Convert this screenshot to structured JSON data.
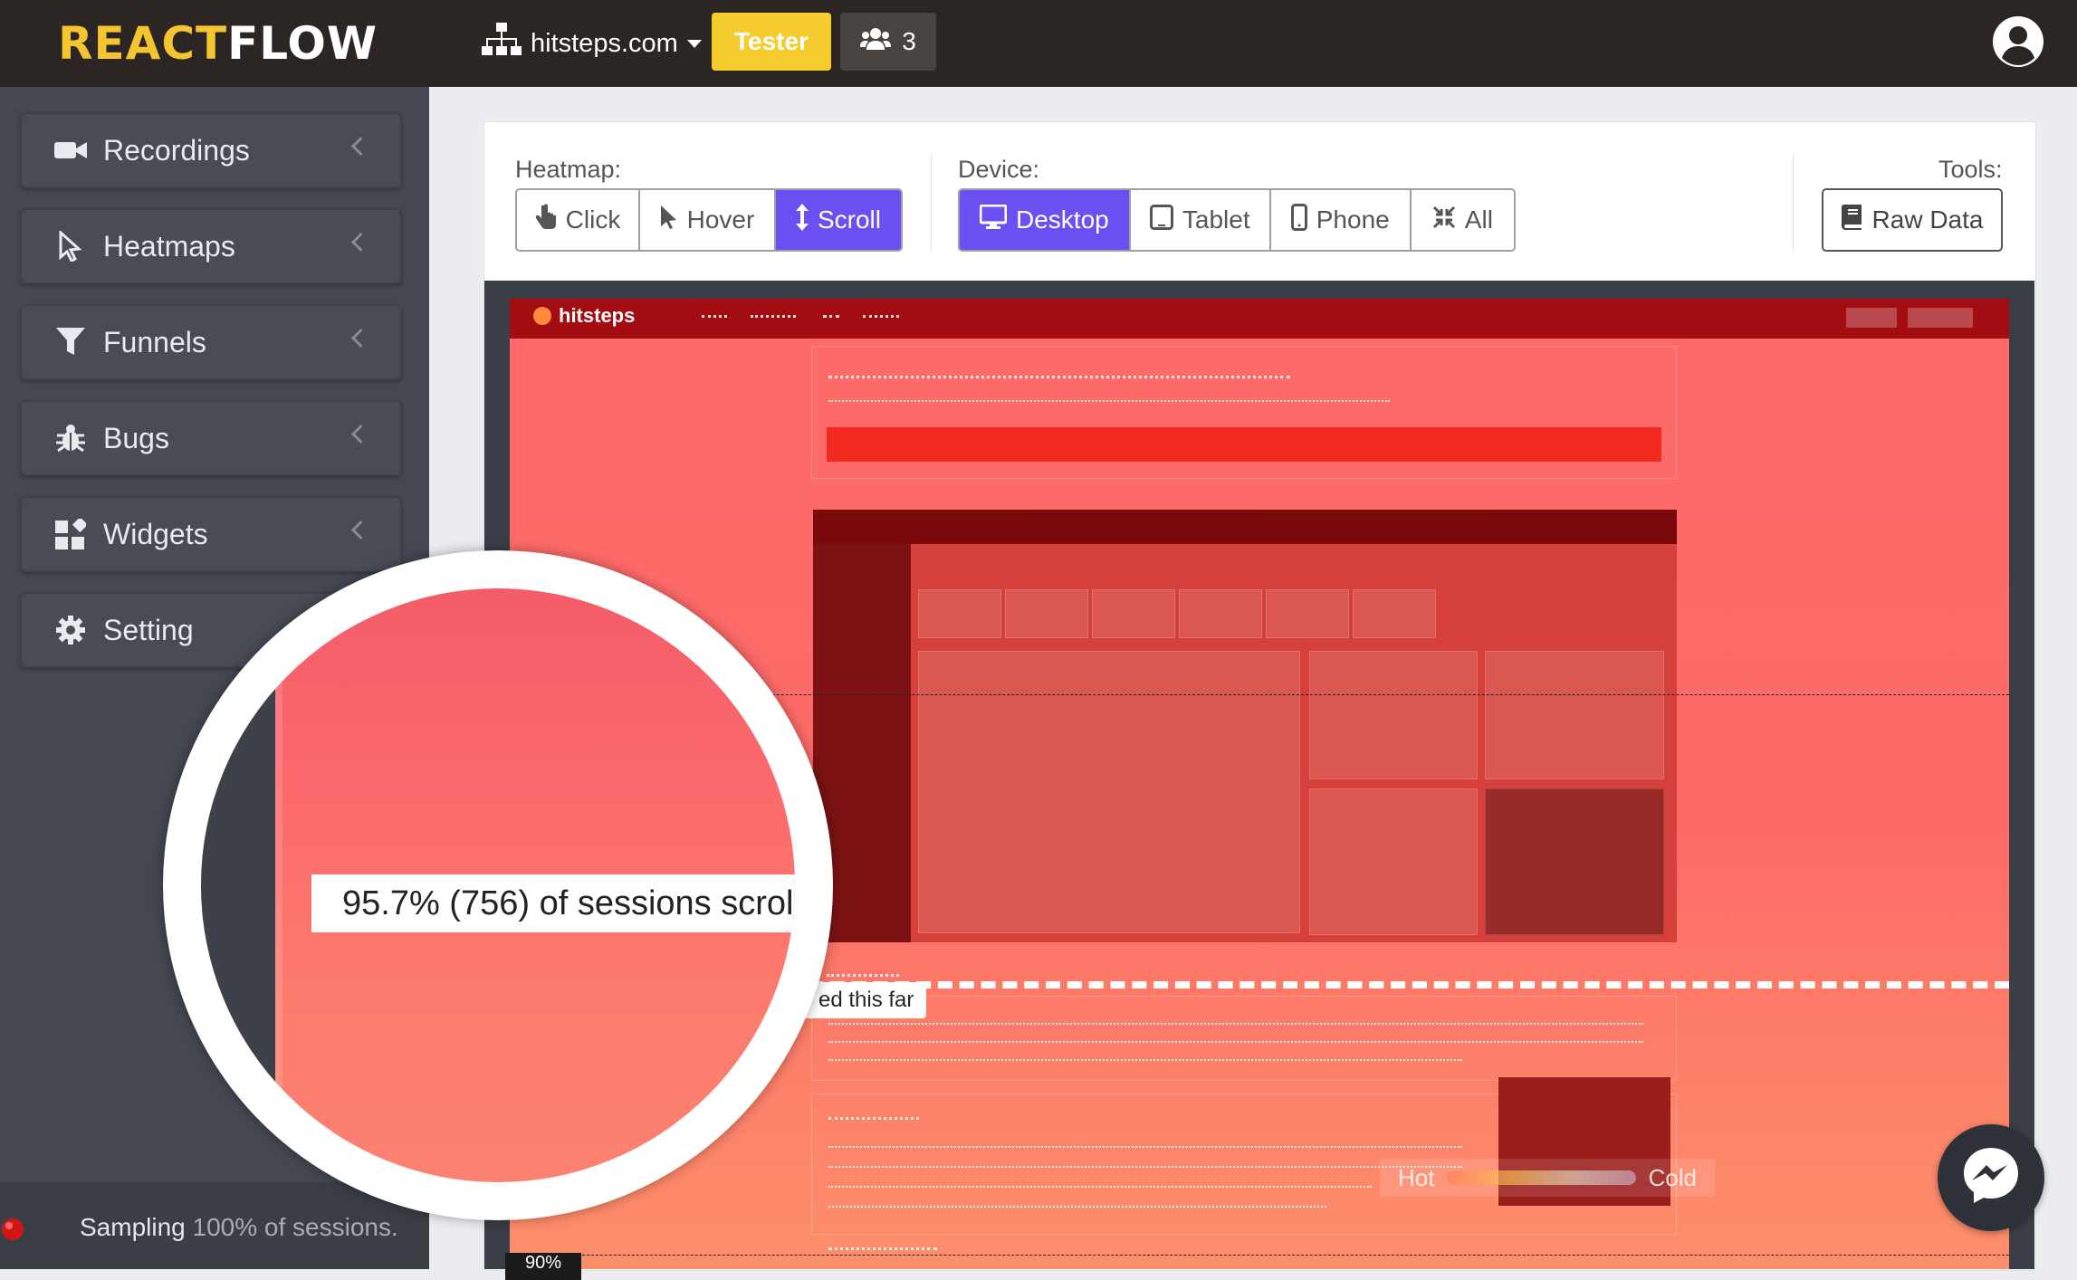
{
  "app": {
    "logo_part1": "REACT",
    "logo_part2": "FLOW"
  },
  "topbar": {
    "site": "hitsteps.com",
    "tester_label": "Tester",
    "users_count": "3"
  },
  "sidebar": {
    "items": [
      {
        "label": "Recordings",
        "icon": "video-camera-icon"
      },
      {
        "label": "Heatmaps",
        "icon": "cursor-icon"
      },
      {
        "label": "Funnels",
        "icon": "filter-icon"
      },
      {
        "label": "Bugs",
        "icon": "bug-icon"
      },
      {
        "label": "Widgets",
        "icon": "widgets-icon"
      },
      {
        "label": "Setting",
        "icon": "gear-icon"
      }
    ],
    "sampling_label": "Sampling",
    "sampling_value": "100% of sessions."
  },
  "toolbar": {
    "heatmap_label": "Heatmap:",
    "heatmap_types": [
      {
        "label": "Click",
        "active": false
      },
      {
        "label": "Hover",
        "active": false
      },
      {
        "label": "Scroll",
        "active": true
      }
    ],
    "device_label": "Device:",
    "devices": [
      {
        "label": "Desktop",
        "active": true
      },
      {
        "label": "Tablet",
        "active": false
      },
      {
        "label": "Phone",
        "active": false
      },
      {
        "label": "All",
        "active": false
      }
    ],
    "tools_label": "Tools:",
    "raw_data_label": "Raw Data"
  },
  "heatmap": {
    "site_logo": "hitsteps",
    "scroll_reach_text": "95.7% (756) of sessions scrolled this far",
    "scroll_reach_tail": "ed this far",
    "legend_hot": "Hot",
    "legend_cold": "Cold",
    "bottom_pct": "90%"
  },
  "colors": {
    "accent": "#6b4ff0",
    "tester": "#f5cb2d",
    "topbar": "#2b2623",
    "sidebar": "#434851",
    "heat": "#fe6a69"
  }
}
